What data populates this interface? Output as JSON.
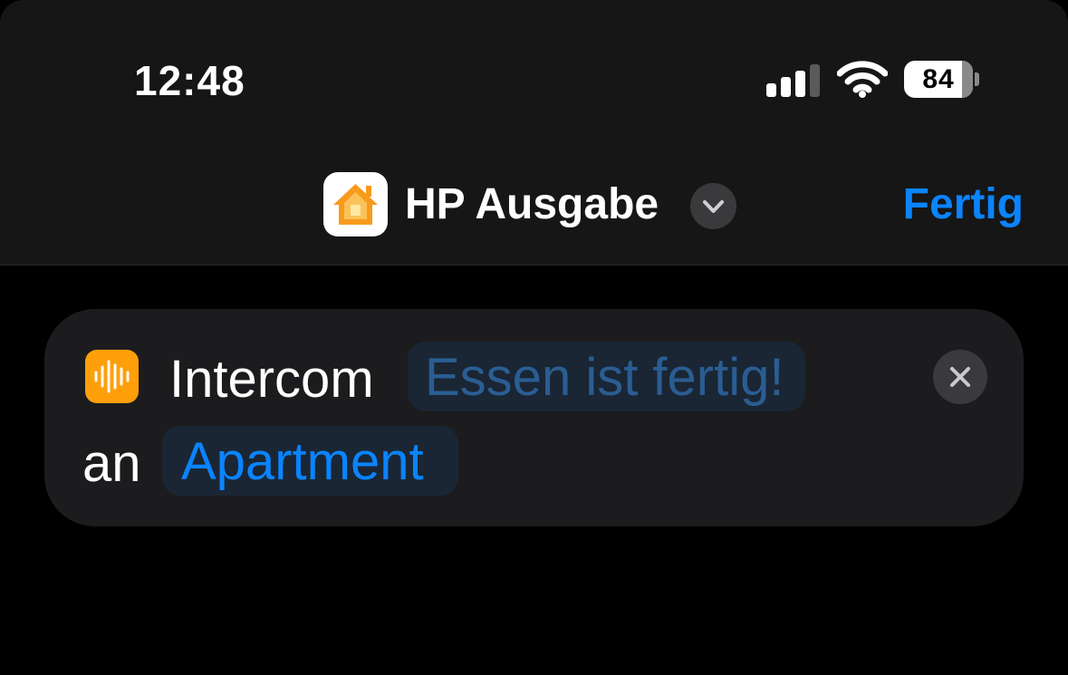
{
  "status_bar": {
    "time": "12:48",
    "battery_percent": "84",
    "signal_bars_filled": 3,
    "signal_bars_total": 4
  },
  "nav_bar": {
    "app_icon": "home-icon",
    "title": "HP Ausgabe",
    "menu_icon": "chevron-down-icon",
    "done_label": "Fertig"
  },
  "action": {
    "icon": "waveform-icon",
    "verb": "Intercom",
    "message_placeholder": "Essen ist fertig!",
    "preposition": "an",
    "home": "Apartment",
    "remove_icon": "close-icon"
  },
  "colors": {
    "accent": "#0a84ff",
    "intercom_orange": "#ff9f0a",
    "card_background": "#1c1c1e",
    "header_background": "#161616"
  }
}
